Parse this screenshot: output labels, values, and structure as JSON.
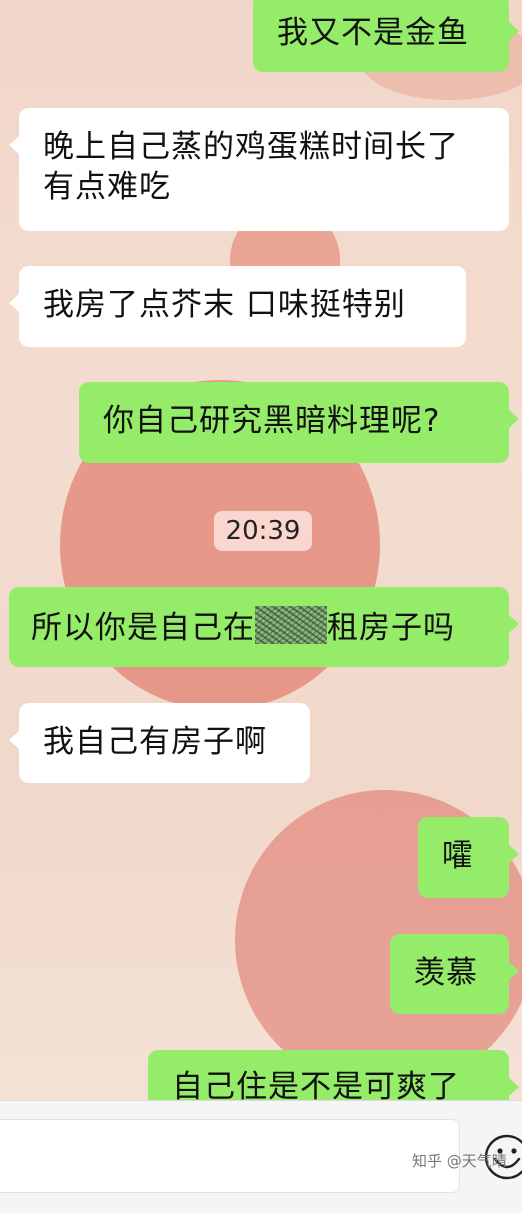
{
  "messages": [
    {
      "side": "out",
      "text": "我又不是金鱼"
    },
    {
      "side": "in",
      "text": "晚上自己蒸的鸡蛋糕时间长了有点难吃"
    },
    {
      "side": "in",
      "text": "我房了点芥末  口味挺特别"
    },
    {
      "side": "out",
      "text": "你自己研究黑暗料理呢?"
    },
    {
      "side": "out",
      "text_before": "所以你是自己在",
      "text_after": "租房子吗"
    },
    {
      "side": "in",
      "text": "我自己有房子啊"
    },
    {
      "side": "out",
      "text": "嚯"
    },
    {
      "side": "out",
      "text": "羡慕"
    },
    {
      "side": "out",
      "text": "自己住是不是可爽了"
    }
  ],
  "timestamp": "20:39",
  "watermark": "知乎 @天气晴",
  "icons": [
    "emoji-icon"
  ],
  "colors": {
    "outgoing_bubble": "#95ec69",
    "incoming_bubble": "#ffffff",
    "input_bar": "#f5f5f5"
  }
}
